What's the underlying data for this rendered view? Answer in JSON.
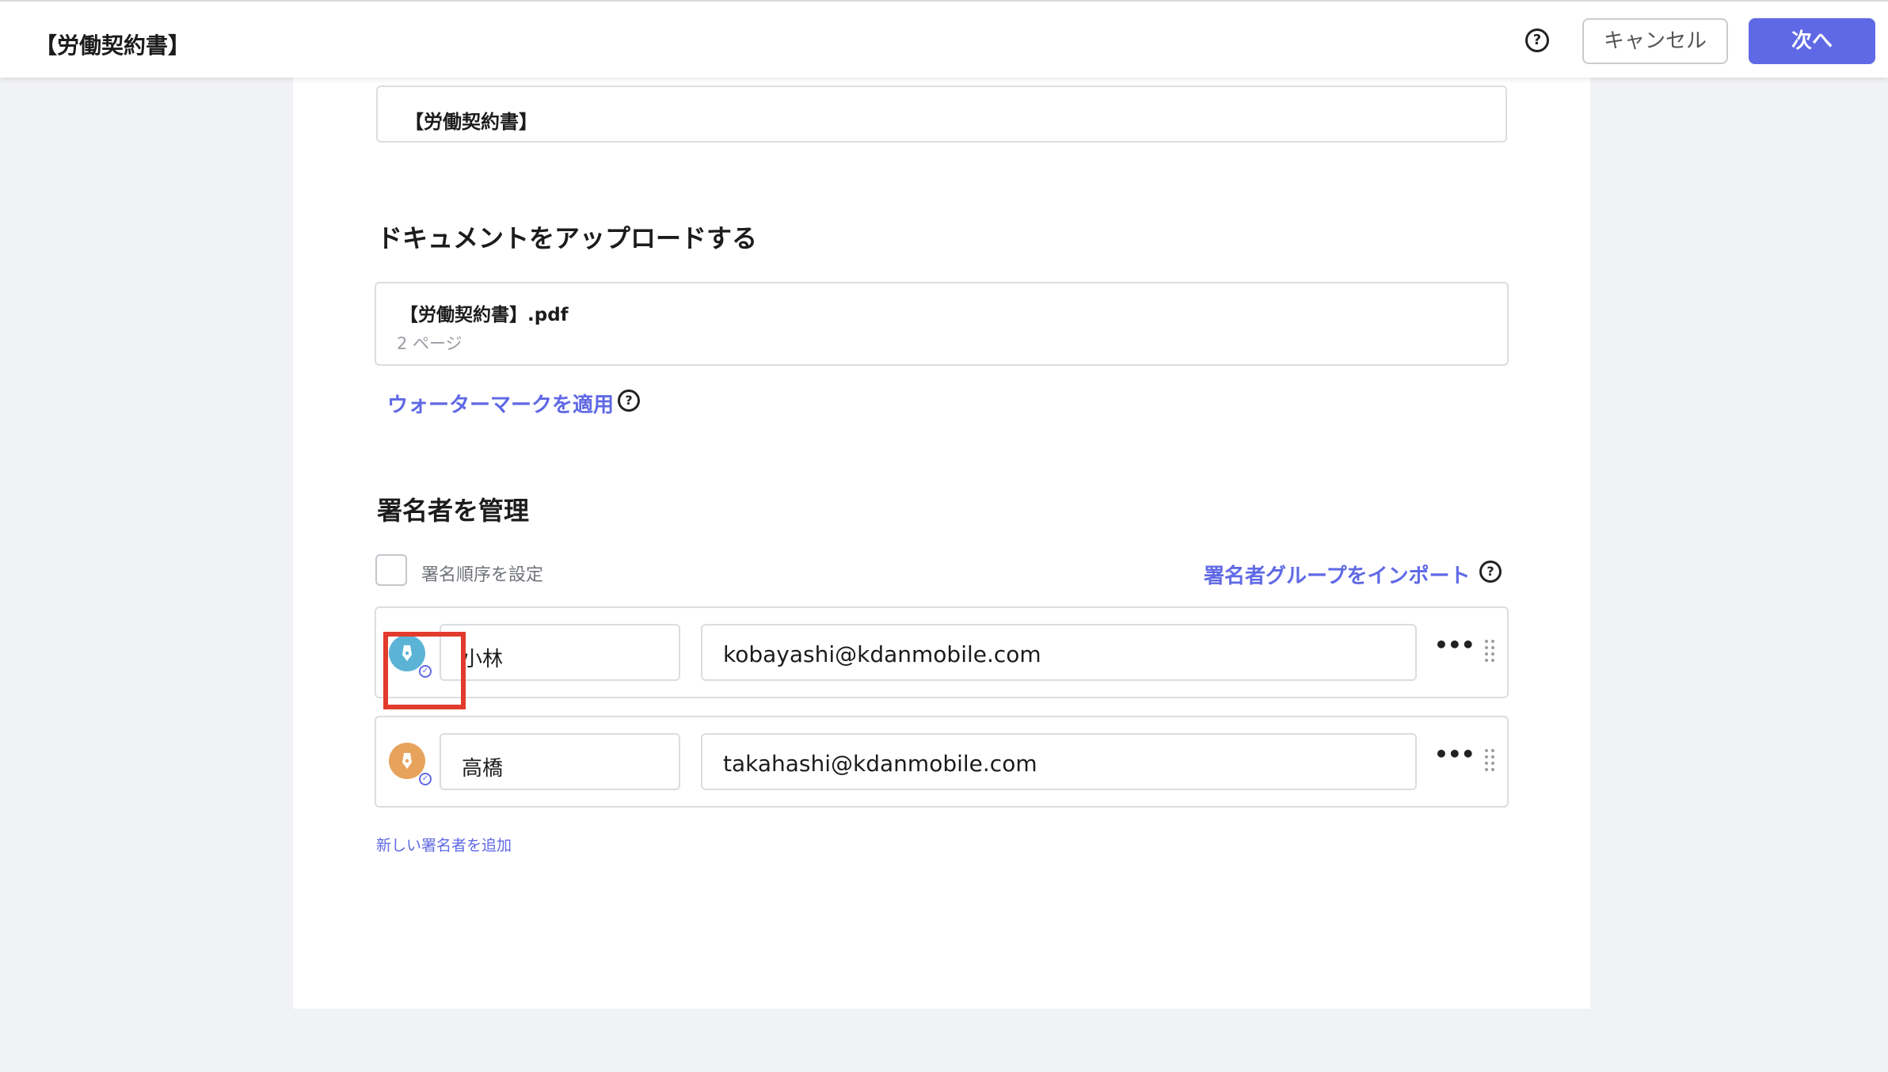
{
  "header": {
    "title": "【労働契約書】",
    "cancel_label": "キャンセル",
    "next_label": "次へ",
    "help_glyph": "?"
  },
  "document_name_value": "【労働契約書】",
  "upload": {
    "section_title": "ドキュメントをアップロードする",
    "file_name": "【労働契約書】.pdf",
    "file_pages": "2 ページ",
    "watermark_link": "ウォーターマークを適用",
    "help_glyph": "?"
  },
  "signers": {
    "section_title": "署名者を管理",
    "order_checkbox_label": "署名順序を設定",
    "order_checkbox_checked": false,
    "import_link": "署名者グループをインポート",
    "help_glyph": "?",
    "items": [
      {
        "name": "小林",
        "email": "kobayashi@kdanmobile.com",
        "avatar_color": "#5bb4d6",
        "more": "•••"
      },
      {
        "name": "高橋",
        "email": "takahashi@kdanmobile.com",
        "avatar_color": "#e7a35c",
        "more": "•••"
      }
    ],
    "add_link": "新しい署名者を追加"
  },
  "colors": {
    "accent": "#5f69e5",
    "highlight": "#e23b2d"
  },
  "icons": {
    "help": "question-circle-icon",
    "avatar": "pen-nib-icon",
    "verified": "check-circle-icon",
    "more": "more-horizontal-icon",
    "drag": "drag-handle-icon"
  }
}
